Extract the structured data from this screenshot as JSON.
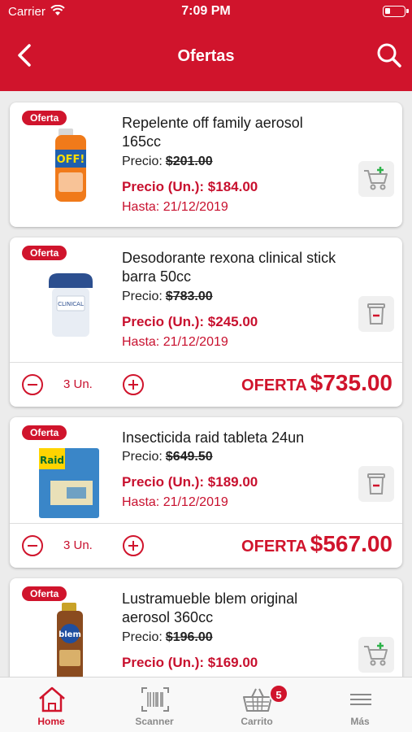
{
  "status_bar": {
    "carrier": "Carrier",
    "time": "7:09 PM"
  },
  "nav": {
    "title": "Ofertas"
  },
  "colors": {
    "brand": "#d0142c",
    "price_red": "#c8102e",
    "add_green": "#2db34a"
  },
  "products": [
    {
      "badge": "Oferta",
      "name": "Repelente off family aerosol 165cc",
      "price_label": "Precio:",
      "old_price": "$201.00",
      "unit_price": "Precio (Un.): $184.00",
      "until": "Hasta: 21/12/2019",
      "action_icon": "cart-add-icon"
    },
    {
      "badge": "Oferta",
      "name": "Desodorante rexona clinical stick barra 50cc",
      "price_label": "Precio:",
      "old_price": "$783.00",
      "unit_price": "Precio (Un.): $245.00",
      "until": "Hasta: 21/12/2019",
      "action_icon": "trash-icon",
      "quantity": "3 Un.",
      "offer_label": "OFERTA",
      "offer_total": "$735.00"
    },
    {
      "badge": "Oferta",
      "name": "Insecticida raid tableta 24un",
      "price_label": "Precio:",
      "old_price": "$649.50",
      "unit_price": "Precio (Un.): $189.00",
      "until": "Hasta: 21/12/2019",
      "action_icon": "trash-icon",
      "quantity": "3 Un.",
      "offer_label": "OFERTA",
      "offer_total": "$567.00"
    },
    {
      "badge": "Oferta",
      "name": "Lustramueble blem original aerosol 360cc",
      "price_label": "Precio:",
      "old_price": "$196.00",
      "unit_price": "Precio (Un.): $169.00",
      "action_icon": "cart-add-icon"
    }
  ],
  "tabbar": {
    "tabs": [
      {
        "label": "Home",
        "icon": "home-icon"
      },
      {
        "label": "Scanner",
        "icon": "barcode-scanner-icon"
      },
      {
        "label": "Carrito",
        "icon": "basket-icon",
        "badge": "5"
      },
      {
        "label": "Más",
        "icon": "menu-icon"
      }
    ]
  }
}
